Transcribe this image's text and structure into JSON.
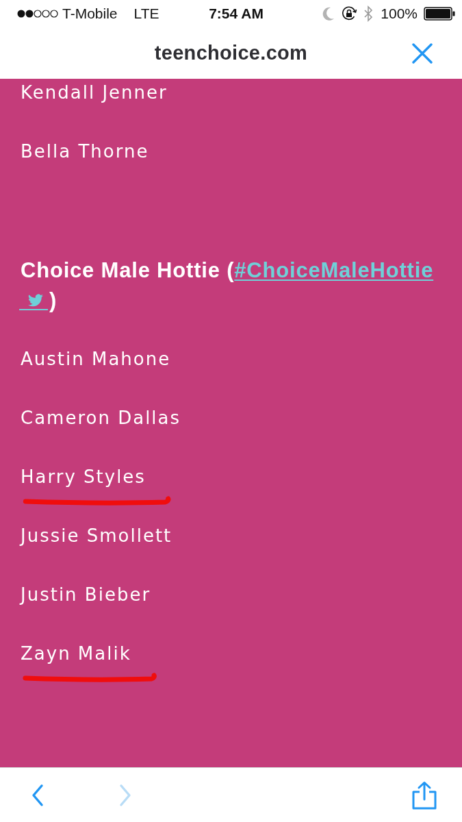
{
  "status_bar": {
    "carrier": "T-Mobile",
    "network": "LTE",
    "time": "7:54 AM",
    "battery": "100%"
  },
  "address_bar": {
    "url": "teenchoice.com"
  },
  "sections": [
    {
      "nominees": [
        {
          "name": "Kendall Jenner",
          "underlined": false
        },
        {
          "name": "Bella Thorne",
          "underlined": false
        }
      ]
    },
    {
      "title": "Choice Male Hottie (",
      "hashtag": "#ChoiceMaleHottie",
      "title_end": ")",
      "nominees": [
        {
          "name": "Austin Mahone",
          "underlined": false
        },
        {
          "name": "Cameron Dallas",
          "underlined": false
        },
        {
          "name": "Harry Styles",
          "underlined": true
        },
        {
          "name": "Jussie Smollett",
          "underlined": false
        },
        {
          "name": "Justin Bieber",
          "underlined": false
        },
        {
          "name": "Zayn Malik",
          "underlined": true
        }
      ]
    }
  ],
  "toolbar": {
    "back": {
      "disabled": false
    },
    "forward": {
      "disabled": true
    }
  }
}
